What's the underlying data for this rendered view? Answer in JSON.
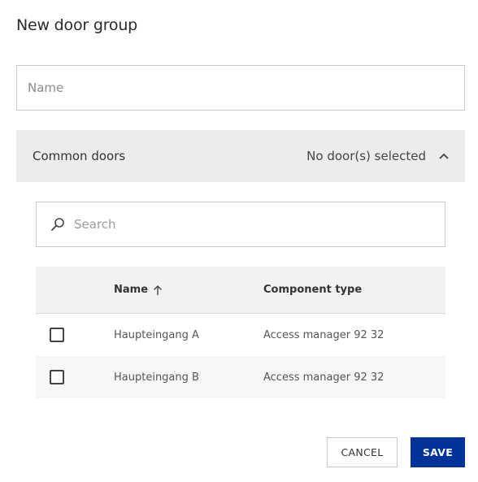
{
  "dialog": {
    "title": "New door group"
  },
  "name_field": {
    "placeholder": "Name",
    "value": ""
  },
  "accordion": {
    "title": "Common doors",
    "status": "No door(s) selected",
    "expanded": true,
    "icon": "chevron-up-icon"
  },
  "search": {
    "placeholder": "Search",
    "value": "",
    "icon": "search-icon"
  },
  "table": {
    "headers": {
      "name": "Name",
      "component_type": "Component type"
    },
    "sort_icon": "arrow-up-icon",
    "rows": [
      {
        "name": "Haupteingang A",
        "component_type": "Access manager 92 32",
        "checked": false
      },
      {
        "name": "Haupteingang B",
        "component_type": "Access manager 92 32",
        "checked": false
      }
    ]
  },
  "actions": {
    "cancel_label": "CANCEL",
    "save_label": "SAVE"
  },
  "colors": {
    "primary": "#003399",
    "accordion_bg": "#ececec",
    "table_header_bg": "#f2f2f2",
    "border": "#c8c8c8"
  }
}
